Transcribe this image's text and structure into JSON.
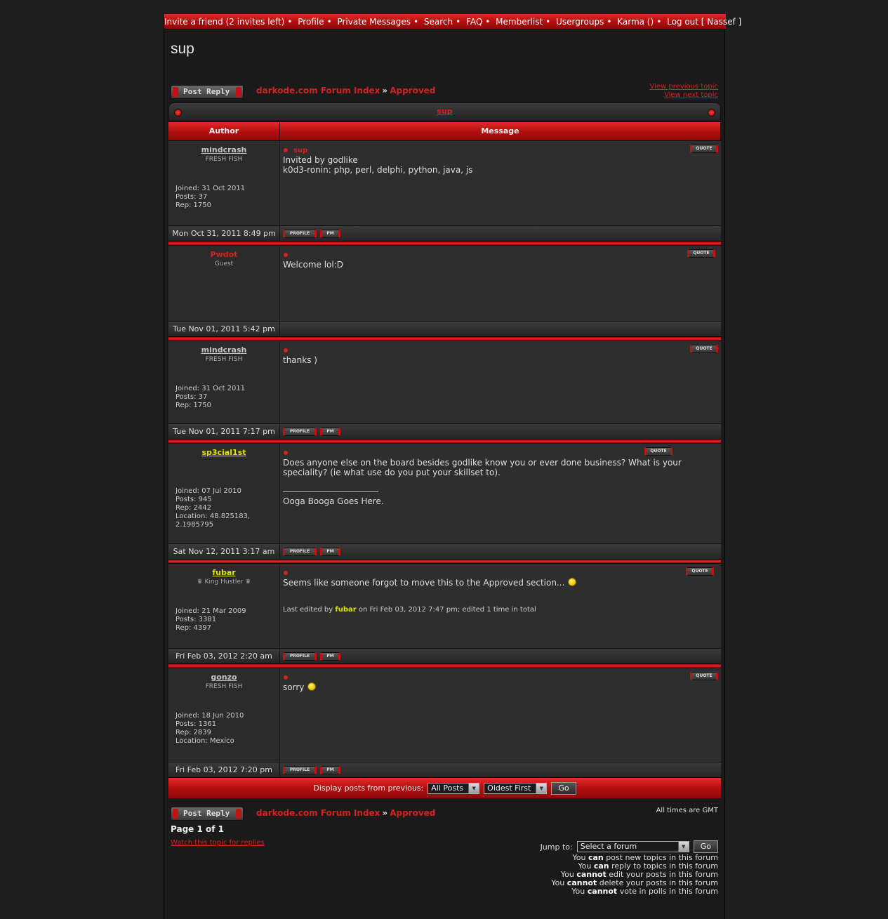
{
  "topnav": {
    "items": [
      "Invite a friend (2 invites left)",
      "Profile",
      "Private Messages",
      "Search",
      "FAQ",
      "Memberlist",
      "Usergroups",
      "Karma ()",
      "Log out [ Nassef ]"
    ],
    "separator": "•"
  },
  "topic": {
    "title": "sup"
  },
  "buttons": {
    "post_reply": "Post Reply",
    "quote": "QUOTE",
    "profile": "PROFILE",
    "pm": "PM",
    "go": "Go"
  },
  "breadcrumb": {
    "index": "darkode.com Forum Index",
    "raquo": "»",
    "forum": "Approved"
  },
  "topic_nav": {
    "prev": "View previous topic",
    "next": "View next topic"
  },
  "table": {
    "caption": "sup",
    "col_author": "Author",
    "col_message": "Message"
  },
  "posts": [
    {
      "author": "mindcrash",
      "rank": "FRESH FISH",
      "stats": [
        "Joined: 31 Oct 2011",
        "Posts: 37",
        "Rep: 1750"
      ],
      "subject": "sup",
      "message": "Invited by godlike\nk0d3-ronin: php, perl, delphi, python, java, js",
      "date": "Mon Oct 31, 2011 8:49 pm"
    },
    {
      "author": "Pwdot",
      "rank": "Guest",
      "stats": [],
      "subject": "",
      "message": "Welcome lol:D",
      "date": "Tue Nov 01, 2011 5:42 pm"
    },
    {
      "author": "mindcrash",
      "rank": "FRESH FISH",
      "stats": [
        "Joined: 31 Oct 2011",
        "Posts: 37",
        "Rep: 1750"
      ],
      "subject": "",
      "message": "thanks )",
      "date": "Tue Nov 01, 2011 7:17 pm"
    },
    {
      "author": "sp3cial1st",
      "rank": "",
      "stats": [
        "Joined: 07 Jul 2010",
        "Posts: 945",
        "Rep: 2442",
        "Location: 48.825183, 2.1985795"
      ],
      "subject": "",
      "message": "Does anyone else on the board besides godlike know you or ever done business? What is your speciality? (ie what use do you put your skillset to).",
      "signature": "Ooga Booga Goes Here.",
      "date": "Sat Nov 12, 2011 3:17 am"
    },
    {
      "author": "fubar",
      "rank": "♛ King Hustler ♛",
      "stats": [
        "Joined: 21 Mar 2009",
        "Posts: 3381",
        "Rep: 4397"
      ],
      "subject": "",
      "message": "Seems like someone forgot to move this to the Approved section...",
      "edited_prefix": "Last edited by",
      "edited_user": "fubar",
      "edited_suffix": "on Fri Feb 03, 2012 7:47 pm; edited 1 time in total",
      "date": "Fri Feb 03, 2012 2:20 am"
    },
    {
      "author": "gonzo",
      "rank": "FRESH FISH",
      "stats": [
        "Joined: 18 Jun 2010",
        "Posts: 1361",
        "Rep: 2839",
        "Location: Mexico"
      ],
      "subject": "",
      "message": "sorry",
      "date": "Fri Feb 03, 2012 7:20 pm"
    }
  ],
  "display": {
    "label": "Display posts from previous:",
    "range": "All Posts",
    "order": "Oldest First"
  },
  "footer": {
    "timezone": "All times are GMT",
    "page": "Page 1 of 1",
    "watch": "Watch this topic for replies",
    "jump_label": "Jump to:",
    "jump_select": "Select a forum",
    "perms": [
      [
        "You",
        "can",
        "post new topics in this forum"
      ],
      [
        "You",
        "can",
        "reply to topics in this forum"
      ],
      [
        "You",
        "cannot",
        "edit your posts in this forum"
      ],
      [
        "You",
        "cannot",
        "delete your posts in this forum"
      ],
      [
        "You",
        "cannot",
        "vote in polls in this forum"
      ]
    ]
  },
  "colors": {
    "accent_red": "#d42222",
    "bar_red": "#b40f0f",
    "user_yellow": "#e3e300"
  }
}
